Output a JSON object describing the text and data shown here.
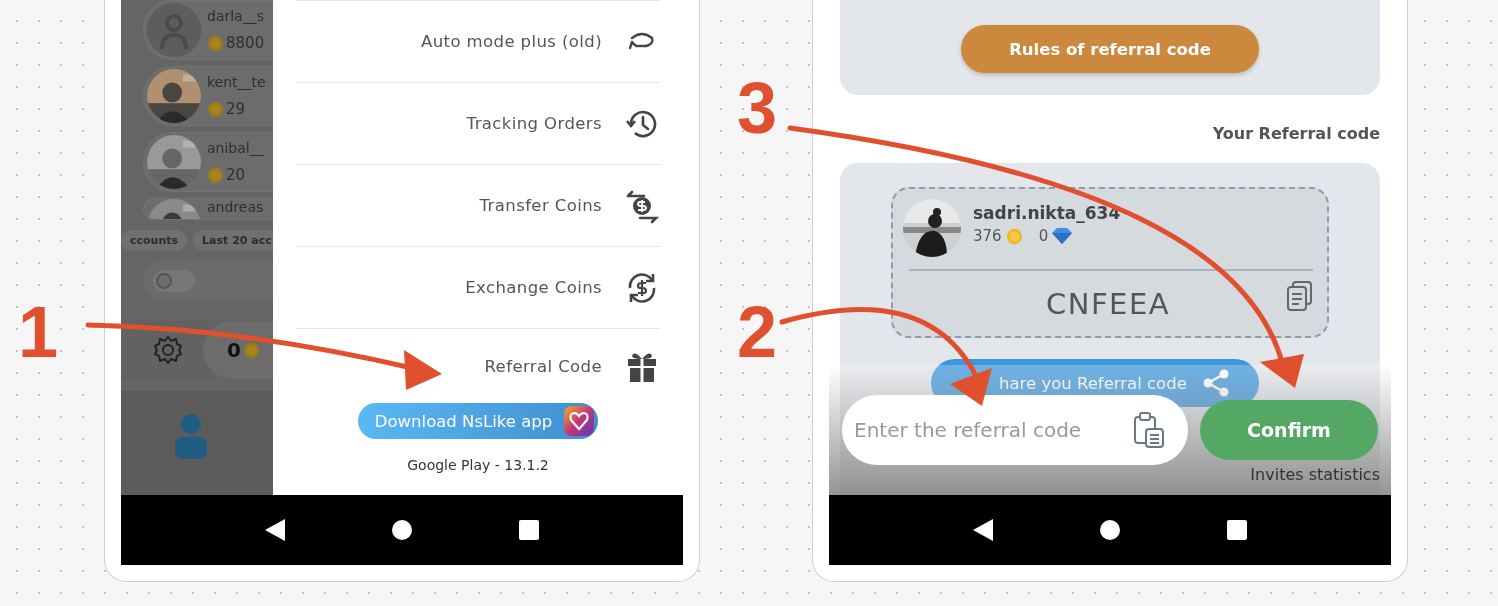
{
  "left_phone": {
    "accounts": [
      {
        "username": "darla__s",
        "coins": "8800",
        "kind": "placeholder"
      },
      {
        "username": "kent__te",
        "coins": "29"
      },
      {
        "username": "anibal__",
        "coins": "20"
      },
      {
        "username": "andreas"
      }
    ],
    "filter_chips": [
      "ccounts",
      "Last 20 acc"
    ],
    "toggle": {
      "on": false
    },
    "balance": "0",
    "menu": [
      {
        "label": "Auto mode plus (old)"
      },
      {
        "label": "Tracking Orders"
      },
      {
        "label": "Transfer Coins"
      },
      {
        "label": "Exchange Coins"
      },
      {
        "label": "Referral Code"
      }
    ],
    "download_button": "Download NsLike app",
    "version": "Google Play - 13.1.2"
  },
  "right_phone": {
    "rules_button": "Rules of referral code",
    "section_title": "Your Referral code",
    "profile": {
      "username": "sadri.nikta_634",
      "coins": "376",
      "gems": "0"
    },
    "referral_code": "CNFEEA",
    "share_button": "hare you Referral code",
    "referral_input": {
      "placeholder": "Enter the referral code"
    },
    "confirm_button": "Confirm",
    "invites_link": "Invites statistics"
  },
  "annotations": [
    {
      "number": "1"
    },
    {
      "number": "2"
    },
    {
      "number": "3"
    }
  ]
}
